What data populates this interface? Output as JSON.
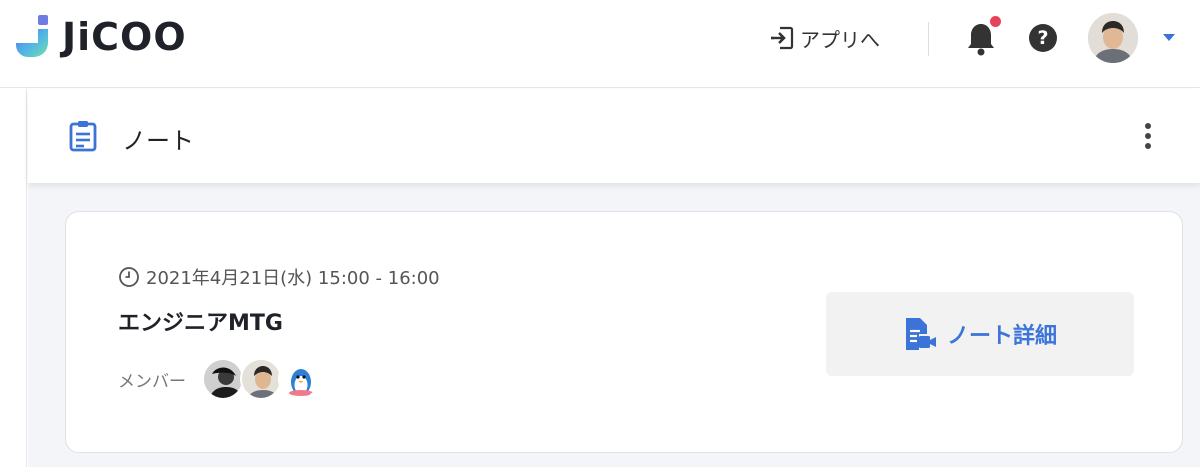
{
  "header": {
    "logo_text": "JiCOO",
    "to_app_label": "アプリへ",
    "icons": {
      "to_app": "login-arrow-icon",
      "bell": "bell-icon",
      "help": "help-circle-icon",
      "caret": "caret-down-icon"
    },
    "help_glyph": "?",
    "accent_color": "#3b73d9",
    "notification_dot_color": "#e8425b"
  },
  "section": {
    "title": "ノート",
    "icon": "clipboard-icon",
    "menu_icon": "more-vertical-icon"
  },
  "note_card": {
    "datetime": "2021年4月21日(水) 15:00 - 16:00",
    "title": "エンジニアMTG",
    "members_label": "メンバー",
    "members": [
      "member-avatar",
      "member-avatar",
      "member-avatar"
    ],
    "detail_button_label": "ノート詳細",
    "detail_button_icon": "note-video-icon"
  }
}
